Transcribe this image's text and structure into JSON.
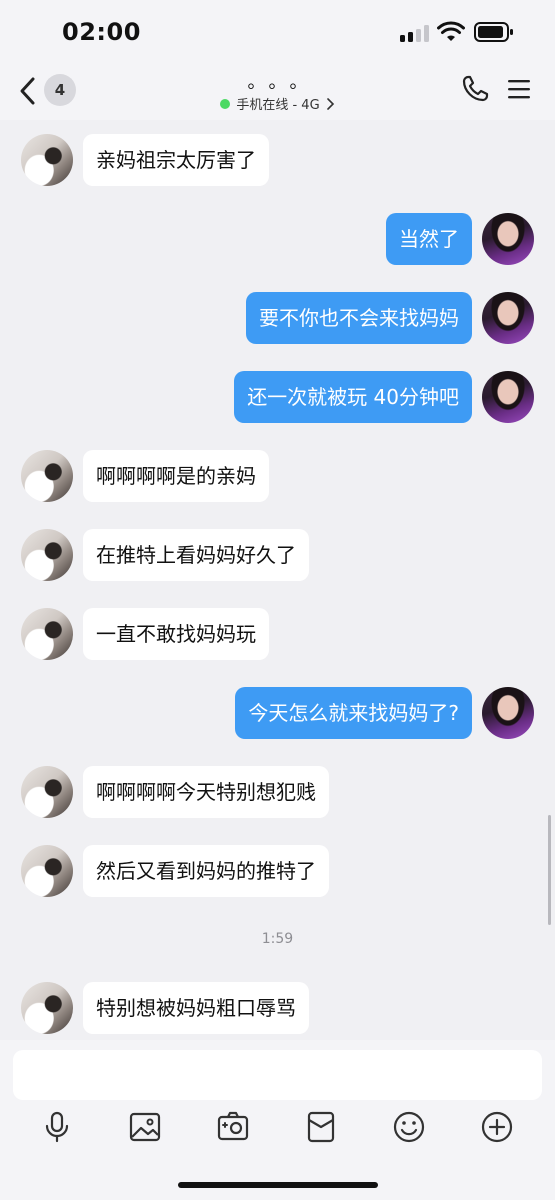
{
  "status": {
    "time": "02:00"
  },
  "header": {
    "unread_count": "4",
    "title": "。。。",
    "online_status": "手机在线 - 4G"
  },
  "messages": [
    {
      "side": "in",
      "text": "亲妈祖宗太厉害了"
    },
    {
      "side": "out",
      "text": "当然了"
    },
    {
      "side": "out",
      "text": "要不你也不会来找妈妈"
    },
    {
      "side": "out",
      "text": "还一次就被玩 40分钟吧"
    },
    {
      "side": "in",
      "text": "啊啊啊啊是的亲妈"
    },
    {
      "side": "in",
      "text": "在推特上看妈妈好久了"
    },
    {
      "side": "in",
      "text": "一直不敢找妈妈玩"
    },
    {
      "side": "out",
      "text": "今天怎么就来找妈妈了?"
    },
    {
      "side": "in",
      "text": "啊啊啊啊今天特别想犯贱"
    },
    {
      "side": "in",
      "text": "然后又看到妈妈的推特了"
    },
    {
      "side": "time",
      "text": "1:59"
    },
    {
      "side": "in",
      "text": "特别想被妈妈粗口辱骂"
    }
  ],
  "input": {
    "placeholder": "",
    "value": ""
  },
  "toolbar": [
    "microphone-icon",
    "image-icon",
    "camera-icon",
    "red-packet-icon",
    "emoji-icon",
    "plus-icon"
  ],
  "colors": {
    "outgoing_bubble": "#3e9bf4",
    "incoming_bubble": "#ffffff",
    "background": "#f0f0f3",
    "online": "#4cd964"
  }
}
